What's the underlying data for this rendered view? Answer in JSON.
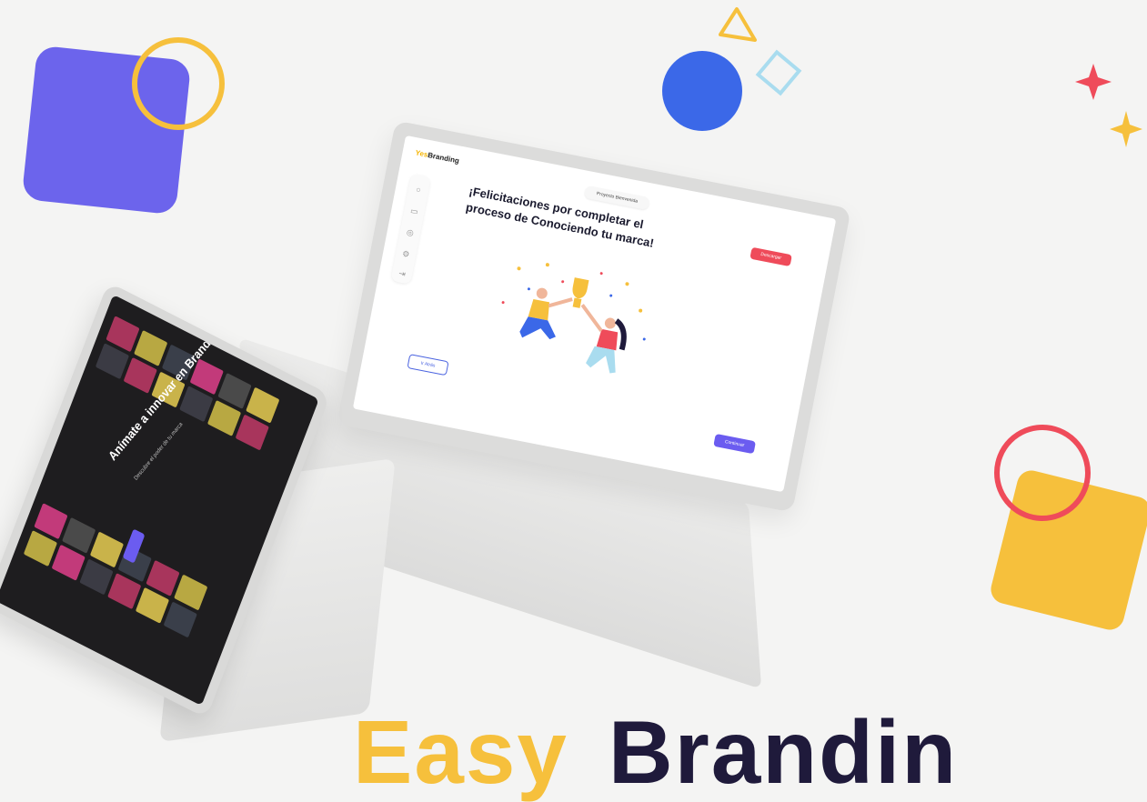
{
  "colors": {
    "background": "#f4f4f3",
    "purple_square": "#6c64ec",
    "yellow": "#f6c03c",
    "blue_circle": "#3b68e8",
    "red": "#ef4b5a",
    "light_blue": "#a9dcef",
    "navy_text": "#1f1a3b"
  },
  "center_laptop": {
    "logo_prefix": "Yes",
    "logo": "Branding",
    "project_chip": "Proyecto Bienvenida",
    "headline": "¡Felicitaciones por completar el proceso de Conociendo tu marca!",
    "red_button": "Descargar",
    "back_button": "Ir Atrás",
    "continue_button": "Continuar"
  },
  "left_laptop": {
    "headline": "Anímate a innovar en Branding",
    "subtext": "Descubre el poder de tu marca"
  },
  "bottom_title": {
    "part1": "Easy",
    "part2": "Brandin"
  }
}
